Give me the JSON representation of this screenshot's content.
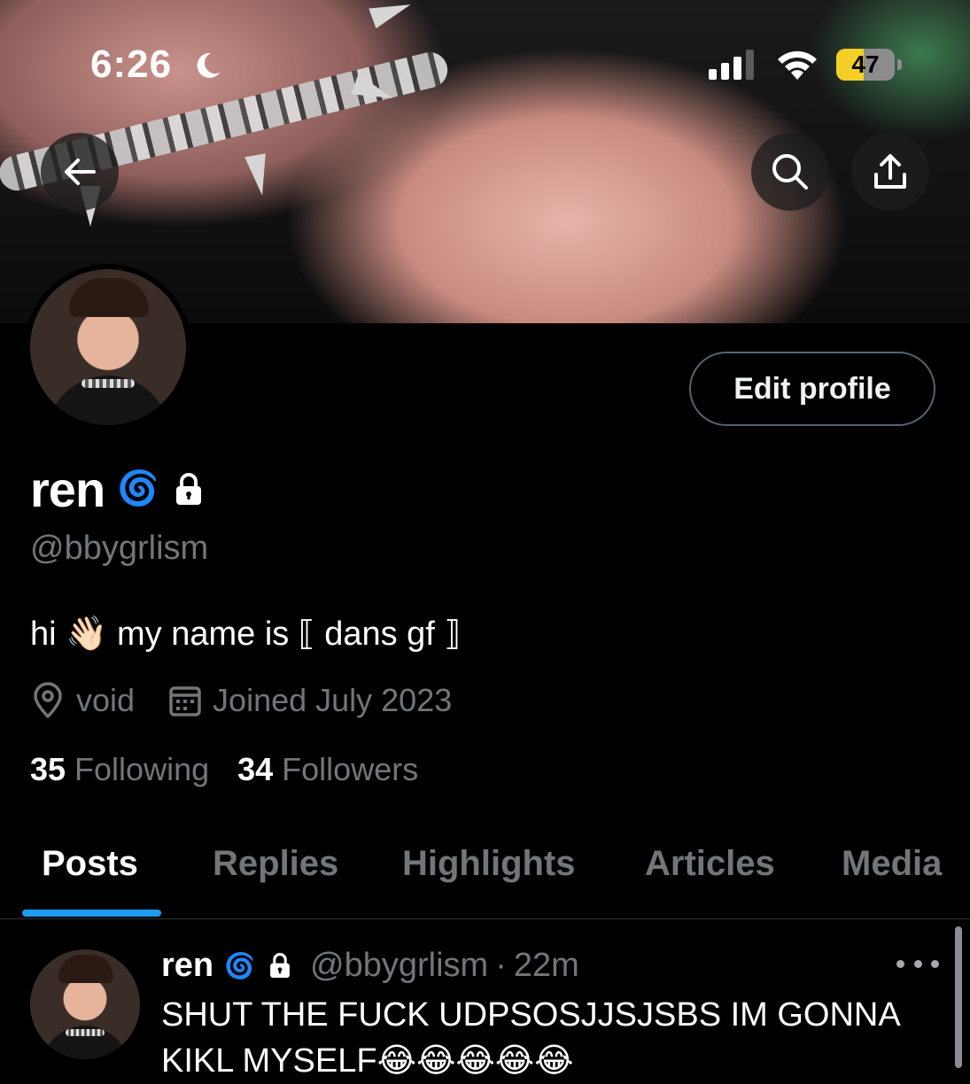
{
  "status_bar": {
    "time": "6:26",
    "moon": "moon-icon",
    "signal_bars": 3,
    "battery_level": "47",
    "battery_color": "#f5cf28"
  },
  "header": {
    "back_icon": "arrow-left-icon",
    "search_icon": "search-icon",
    "share_icon": "share-icon"
  },
  "profile": {
    "edit_label": "Edit profile",
    "display_name": "ren",
    "name_emoji": "🌀",
    "handle": "@bbygrlism",
    "bio": "hi 👋🏻 my name is ⟦ dans gf ⟧",
    "location": "void",
    "joined": "Joined July 2023",
    "following_count": "35",
    "following_label": "Following",
    "followers_count": "34",
    "followers_label": "Followers"
  },
  "tabs": [
    {
      "label": "Posts",
      "active": true
    },
    {
      "label": "Replies",
      "active": false
    },
    {
      "label": "Highlights",
      "active": false
    },
    {
      "label": "Articles",
      "active": false
    },
    {
      "label": "Media",
      "active": false
    }
  ],
  "post": {
    "name": "ren",
    "name_emoji": "🌀",
    "handle": "@bbygrlism",
    "separator": "·",
    "time": "22m",
    "text": "SHUT THE FUCK UDPSOSJJSJSBS IM GONNA KIKL MYSELF😂😂😂😂😂"
  },
  "colors": {
    "accent": "#1d9bf0",
    "muted_text": "#71767b",
    "border": "#536471"
  }
}
